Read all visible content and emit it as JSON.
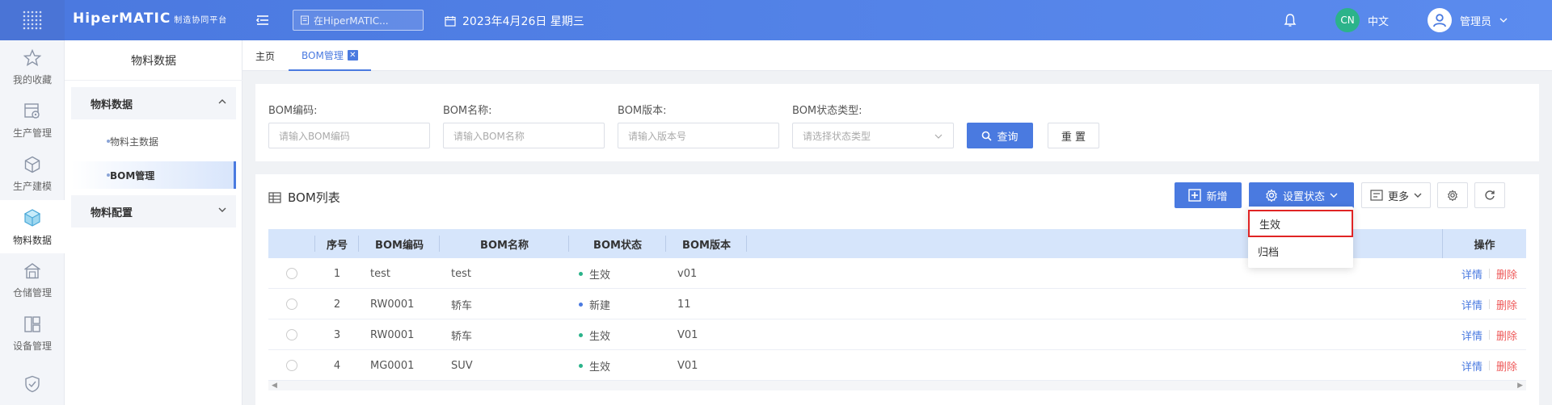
{
  "topbar": {
    "brand": "HiperMATIC",
    "brand_sub": "制造协同平台",
    "search_placeholder": "在HiperMATIC...",
    "date": "2023年4月26日 星期三",
    "lang_badge": "CN",
    "lang_label": "中文",
    "user_label": "管理员"
  },
  "rail": {
    "items": [
      {
        "label": "我的收藏",
        "icon": "star-icon"
      },
      {
        "label": "生产管理",
        "icon": "production-icon"
      },
      {
        "label": "生产建模",
        "icon": "modeling-icon"
      },
      {
        "label": "物料数据",
        "icon": "material-data-icon"
      },
      {
        "label": "仓储管理",
        "icon": "warehouse-icon"
      },
      {
        "label": "设备管理",
        "icon": "equipment-icon"
      },
      {
        "label": "",
        "icon": "quality-icon"
      }
    ]
  },
  "submenu": {
    "title": "物料数据",
    "group1": "物料数据",
    "leaf1": "物料主数据",
    "leaf2": "BOM管理",
    "group2": "物料配置"
  },
  "tabs": {
    "home": "主页",
    "active": "BOM管理"
  },
  "filter": {
    "code_label": "BOM编码:",
    "code_placeholder": "请输入BOM编码",
    "name_label": "BOM名称:",
    "name_placeholder": "请输入BOM名称",
    "version_label": "BOM版本:",
    "version_placeholder": "请输入版本号",
    "status_label": "BOM状态类型:",
    "status_placeholder": "请选择状态类型",
    "query_label": "查询",
    "reset_label": "重 置"
  },
  "list": {
    "title": "BOM列表",
    "add_label": "新增",
    "set_status_label": "设置状态",
    "more_label": "更多",
    "columns": [
      "序号",
      "BOM编码",
      "BOM名称",
      "BOM状态",
      "BOM版本",
      "操作"
    ],
    "rows": [
      {
        "no": "1",
        "code": "test",
        "name": "test",
        "status": "生效",
        "status_color": "#2bb38a",
        "version": "v01"
      },
      {
        "no": "2",
        "code": "RW0001",
        "name": "轿车",
        "status": "新建",
        "status_color": "#4a7ae0",
        "version": "11"
      },
      {
        "no": "3",
        "code": "RW0001",
        "name": "轿车",
        "status": "生效",
        "status_color": "#2bb38a",
        "version": "V01"
      },
      {
        "no": "4",
        "code": "MG0001",
        "name": "SUV",
        "status": "生效",
        "status_color": "#2bb38a",
        "version": "V01"
      }
    ],
    "op_detail": "详情",
    "op_delete": "删除"
  },
  "dropdown": {
    "items": [
      "生效",
      "归档"
    ]
  },
  "colors": {
    "accent": "#4a7ae0",
    "danger": "#ee5a5a",
    "success": "#2bb38a",
    "highlight_border": "#e02424"
  }
}
